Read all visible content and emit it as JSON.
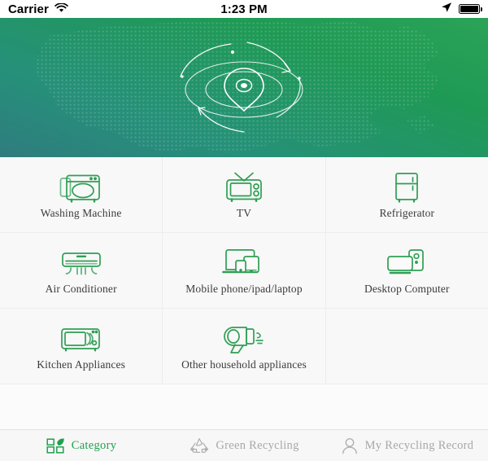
{
  "statusbar": {
    "carrier": "Carrier",
    "wifi_icon": "wifi-icon",
    "time": "1:23 PM",
    "location_icon": "location-arrow-icon",
    "battery_icon": "battery-full-icon"
  },
  "hero": {
    "name": "hero-banner",
    "art_icon": "location-pin-radar-icon",
    "gradient_from": "#2ba358",
    "gradient_to": "#2f7c7e",
    "map_dot_color": "#ffffff"
  },
  "grid": {
    "items": [
      {
        "label": "Washing Machine",
        "icon": "washing-machine-icon"
      },
      {
        "label": "TV",
        "icon": "tv-icon"
      },
      {
        "label": "Refrigerator",
        "icon": "refrigerator-icon"
      },
      {
        "label": "Air Conditioner",
        "icon": "air-conditioner-icon"
      },
      {
        "label": "Mobile phone/ipad/laptop",
        "icon": "mobile-tablet-laptop-icon"
      },
      {
        "label": "Desktop Computer",
        "icon": "desktop-computer-icon"
      },
      {
        "label": "Kitchen Appliances",
        "icon": "microwave-icon"
      },
      {
        "label": "Other household appliances",
        "icon": "hair-dryer-icon"
      }
    ],
    "icon_color": "#2f9e54",
    "label_color": "#3b3b3b"
  },
  "tabbar": {
    "tabs": [
      {
        "label": "Category",
        "icon": "category-grid-icon",
        "active": true
      },
      {
        "label": "Green Recycling",
        "icon": "recycle-icon",
        "active": false
      },
      {
        "label": "My Recycling Record",
        "icon": "user-icon",
        "active": false
      }
    ],
    "active_color": "#21a04f",
    "inactive_color": "#a8a8a8"
  }
}
